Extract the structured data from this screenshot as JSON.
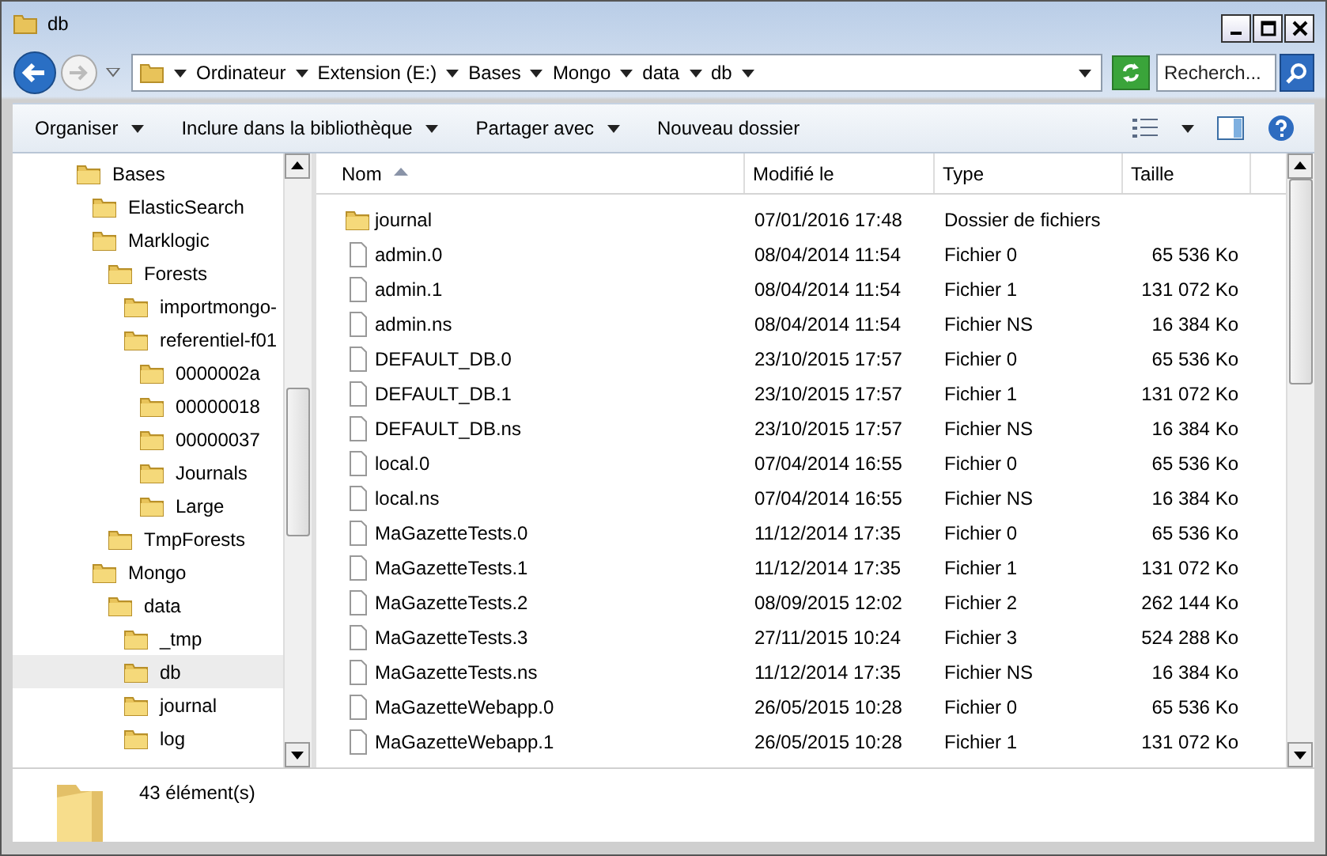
{
  "window": {
    "title": "db"
  },
  "address": {
    "segments": [
      "Ordinateur",
      "Extension (E:)",
      "Bases",
      "Mongo",
      "data",
      "db"
    ]
  },
  "search": {
    "placeholder": "Recherch..."
  },
  "toolbar": {
    "items": [
      {
        "label": "Organiser",
        "dropdown": true
      },
      {
        "label": "Inclure dans la bibliothèque",
        "dropdown": true
      },
      {
        "label": "Partager avec",
        "dropdown": true
      },
      {
        "label": "Nouveau dossier",
        "dropdown": false
      }
    ]
  },
  "tree": [
    {
      "label": "Bases",
      "selected": false,
      "children": [
        {
          "label": "ElasticSearch",
          "selected": false
        },
        {
          "label": "Marklogic",
          "selected": false,
          "children": [
            {
              "label": "Forests",
              "selected": false,
              "children": [
                {
                  "label": "importmongo-",
                  "selected": false
                },
                {
                  "label": "referentiel-f01",
                  "selected": false,
                  "children": [
                    {
                      "label": "0000002a",
                      "selected": false
                    },
                    {
                      "label": "00000018",
                      "selected": false
                    },
                    {
                      "label": "00000037",
                      "selected": false
                    },
                    {
                      "label": "Journals",
                      "selected": false
                    },
                    {
                      "label": "Large",
                      "selected": false
                    }
                  ]
                }
              ]
            },
            {
              "label": "TmpForests",
              "selected": false
            }
          ]
        },
        {
          "label": "Mongo",
          "selected": false,
          "children": [
            {
              "label": "data",
              "selected": false,
              "children": [
                {
                  "label": "_tmp",
                  "selected": false
                },
                {
                  "label": "db",
                  "selected": true
                },
                {
                  "label": "journal",
                  "selected": false
                },
                {
                  "label": "log",
                  "selected": false
                }
              ]
            }
          ]
        }
      ]
    }
  ],
  "table": {
    "columns": [
      {
        "label": "Nom",
        "sorted": true
      },
      {
        "label": "Modifié le",
        "sorted": false
      },
      {
        "label": "Type",
        "sorted": false
      },
      {
        "label": "Taille",
        "sorted": false
      }
    ],
    "rows": [
      {
        "kind": "folder",
        "name": "journal",
        "modified": "07/01/2016 17:48",
        "type": "Dossier de fichiers"
      },
      {
        "kind": "file",
        "name": "admin.0",
        "modified": "08/04/2014 11:54",
        "type": "Fichier 0",
        "size": "65 536 Ko"
      },
      {
        "kind": "file",
        "name": "admin.1",
        "modified": "08/04/2014 11:54",
        "type": "Fichier 1",
        "size": "131 072 Ko"
      },
      {
        "kind": "file",
        "name": "admin.ns",
        "modified": "08/04/2014 11:54",
        "type": "Fichier NS",
        "size": "16 384 Ko"
      },
      {
        "kind": "file",
        "name": "DEFAULT_DB.0",
        "modified": "23/10/2015 17:57",
        "type": "Fichier 0",
        "size": "65 536 Ko"
      },
      {
        "kind": "file",
        "name": "DEFAULT_DB.1",
        "modified": "23/10/2015 17:57",
        "type": "Fichier 1",
        "size": "131 072 Ko"
      },
      {
        "kind": "file",
        "name": "DEFAULT_DB.ns",
        "modified": "23/10/2015 17:57",
        "type": "Fichier NS",
        "size": "16 384 Ko"
      },
      {
        "kind": "file",
        "name": "local.0",
        "modified": "07/04/2014 16:55",
        "type": "Fichier 0",
        "size": "65 536 Ko"
      },
      {
        "kind": "file",
        "name": "local.ns",
        "modified": "07/04/2014 16:55",
        "type": "Fichier NS",
        "size": "16 384 Ko"
      },
      {
        "kind": "file",
        "name": "MaGazetteTests.0",
        "modified": "11/12/2014 17:35",
        "type": "Fichier 0",
        "size": "65 536 Ko"
      },
      {
        "kind": "file",
        "name": "MaGazetteTests.1",
        "modified": "11/12/2014 17:35",
        "type": "Fichier 1",
        "size": "131 072 Ko"
      },
      {
        "kind": "file",
        "name": "MaGazetteTests.2",
        "modified": "08/09/2015 12:02",
        "type": "Fichier 2",
        "size": "262 144 Ko"
      },
      {
        "kind": "file",
        "name": "MaGazetteTests.3",
        "modified": "27/11/2015 10:24",
        "type": "Fichier 3",
        "size": "524 288 Ko"
      },
      {
        "kind": "file",
        "name": "MaGazetteTests.ns",
        "modified": "11/12/2014 17:35",
        "type": "Fichier NS",
        "size": "16 384 Ko"
      },
      {
        "kind": "file",
        "name": "MaGazetteWebapp.0",
        "modified": "26/05/2015 10:28",
        "type": "Fichier 0",
        "size": "65 536 Ko"
      },
      {
        "kind": "file",
        "name": "MaGazetteWebapp.1",
        "modified": "26/05/2015 10:28",
        "type": "Fichier 1",
        "size": "131 072 Ko"
      }
    ]
  },
  "status_bar": {
    "count": "43 élément(s)"
  }
}
